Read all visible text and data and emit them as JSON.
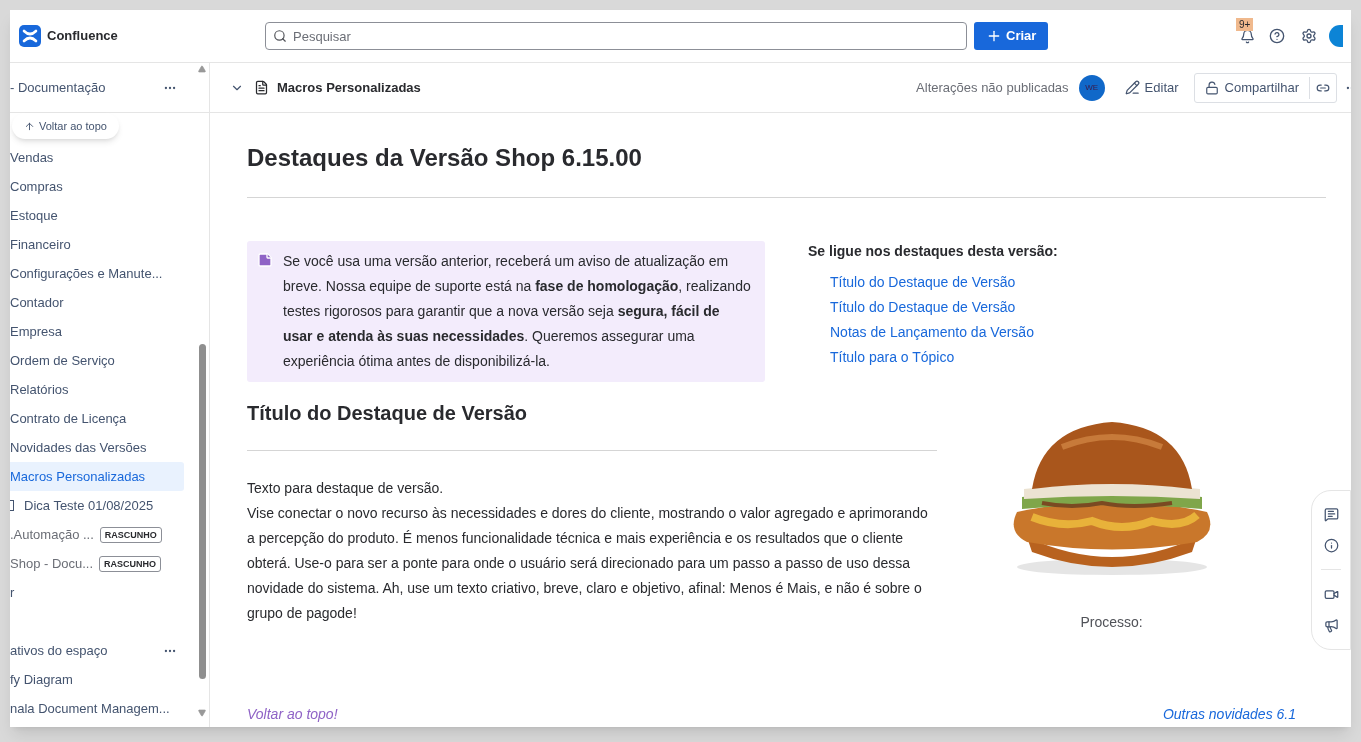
{
  "topbar": {
    "app_name": "Confluence",
    "search": {
      "placeholder": "Pesquisar"
    },
    "create_button": "Criar",
    "notification_badge": "9+"
  },
  "sidebar": {
    "space_title": "- Documentação",
    "back_to_top": "Voltar ao topo",
    "items": [
      {
        "label": "Vendas",
        "selected": false,
        "kind": "page"
      },
      {
        "label": "Compras",
        "selected": false,
        "kind": "page"
      },
      {
        "label": "Estoque",
        "selected": false,
        "kind": "page"
      },
      {
        "label": "Financeiro",
        "selected": false,
        "kind": "page"
      },
      {
        "label": "Configurações e Manute...",
        "selected": false,
        "kind": "page"
      },
      {
        "label": "Contador",
        "selected": false,
        "kind": "page"
      },
      {
        "label": "Empresa",
        "selected": false,
        "kind": "page"
      },
      {
        "label": "Ordem de Serviço",
        "selected": false,
        "kind": "page"
      },
      {
        "label": "Relatórios",
        "selected": false,
        "kind": "page"
      },
      {
        "label": "Contrato de Licença",
        "selected": false,
        "kind": "page"
      },
      {
        "label": "Novidades das Versões",
        "selected": false,
        "kind": "page"
      },
      {
        "label": "Macros Personalizadas",
        "selected": true,
        "kind": "page"
      },
      {
        "label": "Dica Teste 01/08/2025",
        "selected": false,
        "kind": "doc"
      },
      {
        "label": ".Automação ...",
        "selected": false,
        "kind": "draft",
        "badge": "RASCUNHO"
      },
      {
        "label": "Shop - Docu...",
        "selected": false,
        "kind": "draft",
        "badge": "RASCUNHO"
      },
      {
        "label": "r",
        "selected": false,
        "kind": "page"
      }
    ],
    "section_title": "ativos do espaço",
    "apps": [
      "fy Diagram",
      "nala Document Managem..."
    ]
  },
  "page_header": {
    "title": "Macros Personalizadas",
    "status": "Alterações não publicadas",
    "avatar": "WE",
    "edit": "Editar",
    "share": "Compartilhar"
  },
  "content": {
    "title": "Destaques da Versão Shop 6.15.00",
    "note": "Se você usa uma versão anterior, receberá um aviso de atualização em breve. Nossa equipe de suporte está na **fase de homologação**, realizando testes rigorosos para garantir que a nova versão seja **segura, fácil de usar e atenda às suas necessidades**. Queremos assegurar uma experiência ótima antes de disponibilizá-la.",
    "toc_title": "Se ligue nos destaques desta versão:",
    "toc_links": [
      "Título do Destaque de Versão",
      "Título do Destaque de Versão",
      "Notas de Lançamento da Versão",
      "Título para o Tópico"
    ],
    "section_heading": "Título do Destaque de Versão",
    "paragraphs": [
      "Texto para destaque de versão.",
      "Vise conectar o novo recurso às necessidades e dores do cliente, mostrando o valor agregado e aprimorando a percepção do produto. É menos funcionalidade técnica e mais experiência e os resultados que o cliente obterá. Use-o para ser a ponte para onde o usuário será direcionado para um passo a passo de uso dessa novidade do sistema. Ah, use um texto criativo, breve, claro e objetivo, afinal: Menos é Mais, e não é sobre o grupo de pagode!"
    ],
    "image": {
      "kind": "picture",
      "caption": "Processo:"
    },
    "footer_left": "Voltar ao topo!",
    "footer_right": "Outras novidades 6.1"
  }
}
